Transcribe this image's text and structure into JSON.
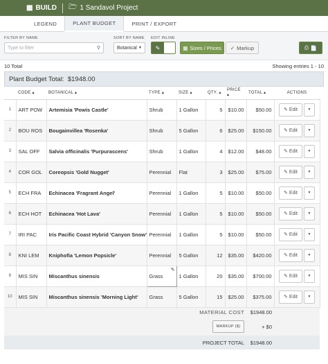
{
  "topbar": {
    "build_label": "BUILD",
    "project_label": "1 Sandavol Project"
  },
  "tabs": [
    {
      "label": "LEGEND"
    },
    {
      "label": "PLANT BUDGET"
    },
    {
      "label": "PRINT / EXPORT"
    }
  ],
  "filters": {
    "filter_label": "FILTER BY NAME",
    "filter_placeholder": "Type to filter",
    "sort_label": "SORT BY NAME",
    "sort_value": "Botanical",
    "edit_label": "EDIT INLINE",
    "sizes_prices_label": "Sizes / Prices",
    "markup_label": "Markup"
  },
  "counts": {
    "total": "10 Total",
    "showing": "Showing entries 1 - 10"
  },
  "budget": {
    "title": "Plant Budget Total:",
    "total": "$1948.00"
  },
  "columns": [
    "CODE",
    "BOTANICAL",
    "TYPE",
    "SIZE",
    "QTY.",
    "PRICE",
    "TOTAL",
    "ACTIONS"
  ],
  "rows": [
    {
      "idx": "1",
      "code": "ART POW",
      "botanical": "Artemisia 'Powis Castle'",
      "type": "Shrub",
      "size": "1 Gallon",
      "qty": "5",
      "price": "$10.00",
      "total": "$50.00"
    },
    {
      "idx": "2",
      "code": "BOU ROS",
      "botanical": "Bougainvillea 'Rosenka'",
      "type": "Shrub",
      "size": "5 Gallon",
      "qty": "6",
      "price": "$25.00",
      "total": "$150.00"
    },
    {
      "idx": "3",
      "code": "SAL OFF",
      "botanical": "Salvia officinalis 'Purpurascens'",
      "type": "Shrub",
      "size": "1 Gallon",
      "qty": "4",
      "price": "$12.00",
      "total": "$48.00"
    },
    {
      "idx": "4",
      "code": "COR GOL",
      "botanical": "Coreopsis 'Gold Nugget'",
      "type": "Perennial",
      "size": "Flat",
      "qty": "3",
      "price": "$25.00",
      "total": "$75.00"
    },
    {
      "idx": "5",
      "code": "ECH FRA",
      "botanical": "Echinacea 'Fragrant Angel'",
      "type": "Perennial",
      "size": "1 Gallon",
      "qty": "5",
      "price": "$10.00",
      "total": "$50.00"
    },
    {
      "idx": "6",
      "code": "ECH HOT",
      "botanical": "Echinacea 'Hot Lava'",
      "type": "Perennial",
      "size": "1 Gallon",
      "qty": "5",
      "price": "$10.00",
      "total": "$50.00"
    },
    {
      "idx": "7",
      "code": "IRI PAC",
      "botanical": "Iris Pacific Coast Hybrid 'Canyon Snow'",
      "type": "Perennial",
      "size": "1 Gallon",
      "qty": "5",
      "price": "$10.00",
      "total": "$50.00"
    },
    {
      "idx": "8",
      "code": "KNI LEM",
      "botanical": "Kniphofia 'Lemon Popsicle'",
      "type": "Perennial",
      "size": "5 Gallon",
      "qty": "12",
      "price": "$35.00",
      "total": "$420.00"
    },
    {
      "idx": "9",
      "code": "MIS SIN",
      "botanical": "Miscanthus sinensis",
      "type": "Grass",
      "size": "1 Gallon",
      "qty": "20",
      "price": "$35.00",
      "total": "$700.00"
    },
    {
      "idx": "10",
      "code": "MIS SIN",
      "botanical": "Miscanthus sinensis 'Morning Light'",
      "type": "Grass",
      "size": "5 Gallon",
      "qty": "15",
      "price": "$25.00",
      "total": "$375.00"
    }
  ],
  "edit_label": "Edit",
  "summary": {
    "material_cost_label": "MATERIAL COST",
    "material_cost": "$1948.00",
    "markup_button": "MARKUP ($)",
    "markup_value": "+ $0",
    "project_total_label": "PROJECT TOTAL",
    "project_total": "$1948.00"
  },
  "colors": {
    "brand": "#5a7245",
    "accent": "#7a9a52"
  }
}
